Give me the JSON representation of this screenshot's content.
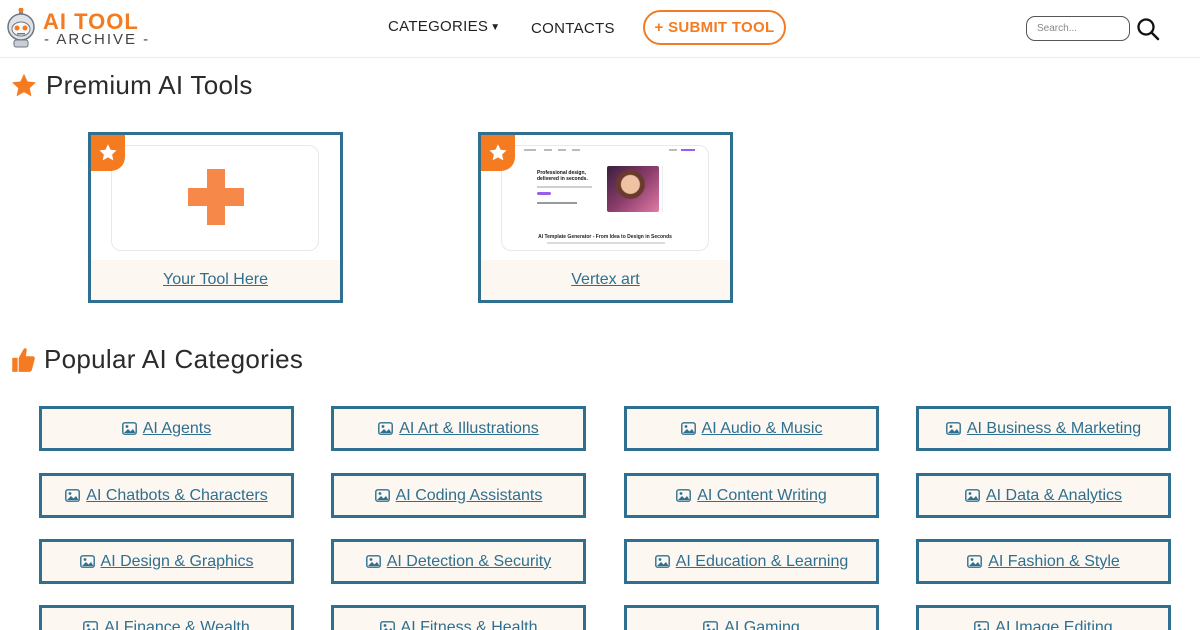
{
  "brand": {
    "title": "AI TOOL",
    "subtitle": "- ARCHIVE -"
  },
  "nav": {
    "categories_label": "CATEGORIES",
    "contacts_label": "CONTACTS",
    "submit_label": "+ SUBMIT TOOL"
  },
  "search": {
    "placeholder": "Search..."
  },
  "premium": {
    "title": "Premium AI Tools",
    "cards": [
      {
        "label": "Your Tool Here"
      },
      {
        "label": "Vertex art",
        "preview": {
          "heading": "Professional design, delivered in seconds.",
          "caption": "AI Template Generator - From Idea to Design in Seconds"
        }
      }
    ]
  },
  "popular": {
    "title": "Popular AI Categories",
    "categories": [
      "AI Agents",
      "AI Art & Illustrations",
      "AI Audio & Music",
      "AI Business & Marketing",
      "AI Chatbots & Characters",
      "AI Coding Assistants",
      "AI Content Writing",
      "AI Data & Analytics",
      "AI Design & Graphics",
      "AI Detection & Security",
      "AI Education & Learning",
      "AI Fashion & Style",
      "AI Finance & Wealth",
      "AI Fitness & Health",
      "AI Gaming",
      "AI Image Editing"
    ]
  },
  "colors": {
    "accent": "#f47b20",
    "link": "#2f6f8f",
    "card_bg": "#fdf7f1"
  },
  "icons": {
    "logo": "robot-icon",
    "search": "search-icon",
    "premium": "star-icon",
    "popular": "thumbs-up-icon",
    "category": "image-icon",
    "placeholder": "plus-icon"
  }
}
